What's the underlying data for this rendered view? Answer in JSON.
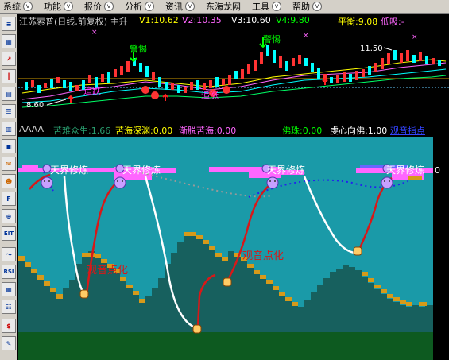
{
  "menu": {
    "items": [
      {
        "label": "系统"
      },
      {
        "label": "功能"
      },
      {
        "label": "报价"
      },
      {
        "label": "分析"
      },
      {
        "label": "资讯"
      },
      {
        "label": "东海龙网"
      },
      {
        "label": "工具"
      },
      {
        "label": "帮助"
      }
    ]
  },
  "toolbar": {
    "buttons": [
      "menu-icon",
      "chart-icon",
      "kline-icon",
      "news-icon",
      "list-icon",
      "doc-icon",
      "calendar-icon",
      "info-icon",
      "money-icon",
      "people-icon",
      "f10-icon",
      "search-icon",
      "eit-icon",
      "wave-icon",
      "rsi-icon",
      "grid-icon",
      "table-icon",
      "dollar-icon",
      "tools-icon"
    ]
  },
  "kline_header": {
    "title": "江苏索普(日线,前复权) 主升",
    "v1": "V1:10.62",
    "v2": "V2:10.35",
    "v3": "V3:10.60",
    "v4": "V4:9.80",
    "pinghen": "平衡:9.08",
    "dixi": "低吸:-"
  },
  "kline_labels": {
    "jingti1": "警惕",
    "jingti2": "警惕",
    "zhuitui1": "追跌",
    "zhuitui2": "追涨",
    "price_low": "8.60",
    "price_high": "11.50"
  },
  "indicator_header": {
    "name": "AAAA",
    "kunan": "苦难众生:1.66",
    "kuhai": "苦海深渊:0.00",
    "jiantuo": "渐脱苦海:0.00",
    "fozhu": "佛珠:0.00",
    "qianxin": "虔心向佛:1.00",
    "guanyin": "观音指点"
  },
  "indicator_labels": {
    "tianjie": "天界修炼",
    "dianhua": "观音点化",
    "zero": "0"
  },
  "colors": {
    "teal": "#1a9aa8",
    "dark_teal": "#17605e",
    "orange": "#d69a1a",
    "green_bottom": "#0d5a20",
    "red_line": "#d81818",
    "white_line": "#ffffff",
    "purple": "#ff66ff",
    "blue_line": "#2222ee",
    "yellow": "#ffff00"
  }
}
